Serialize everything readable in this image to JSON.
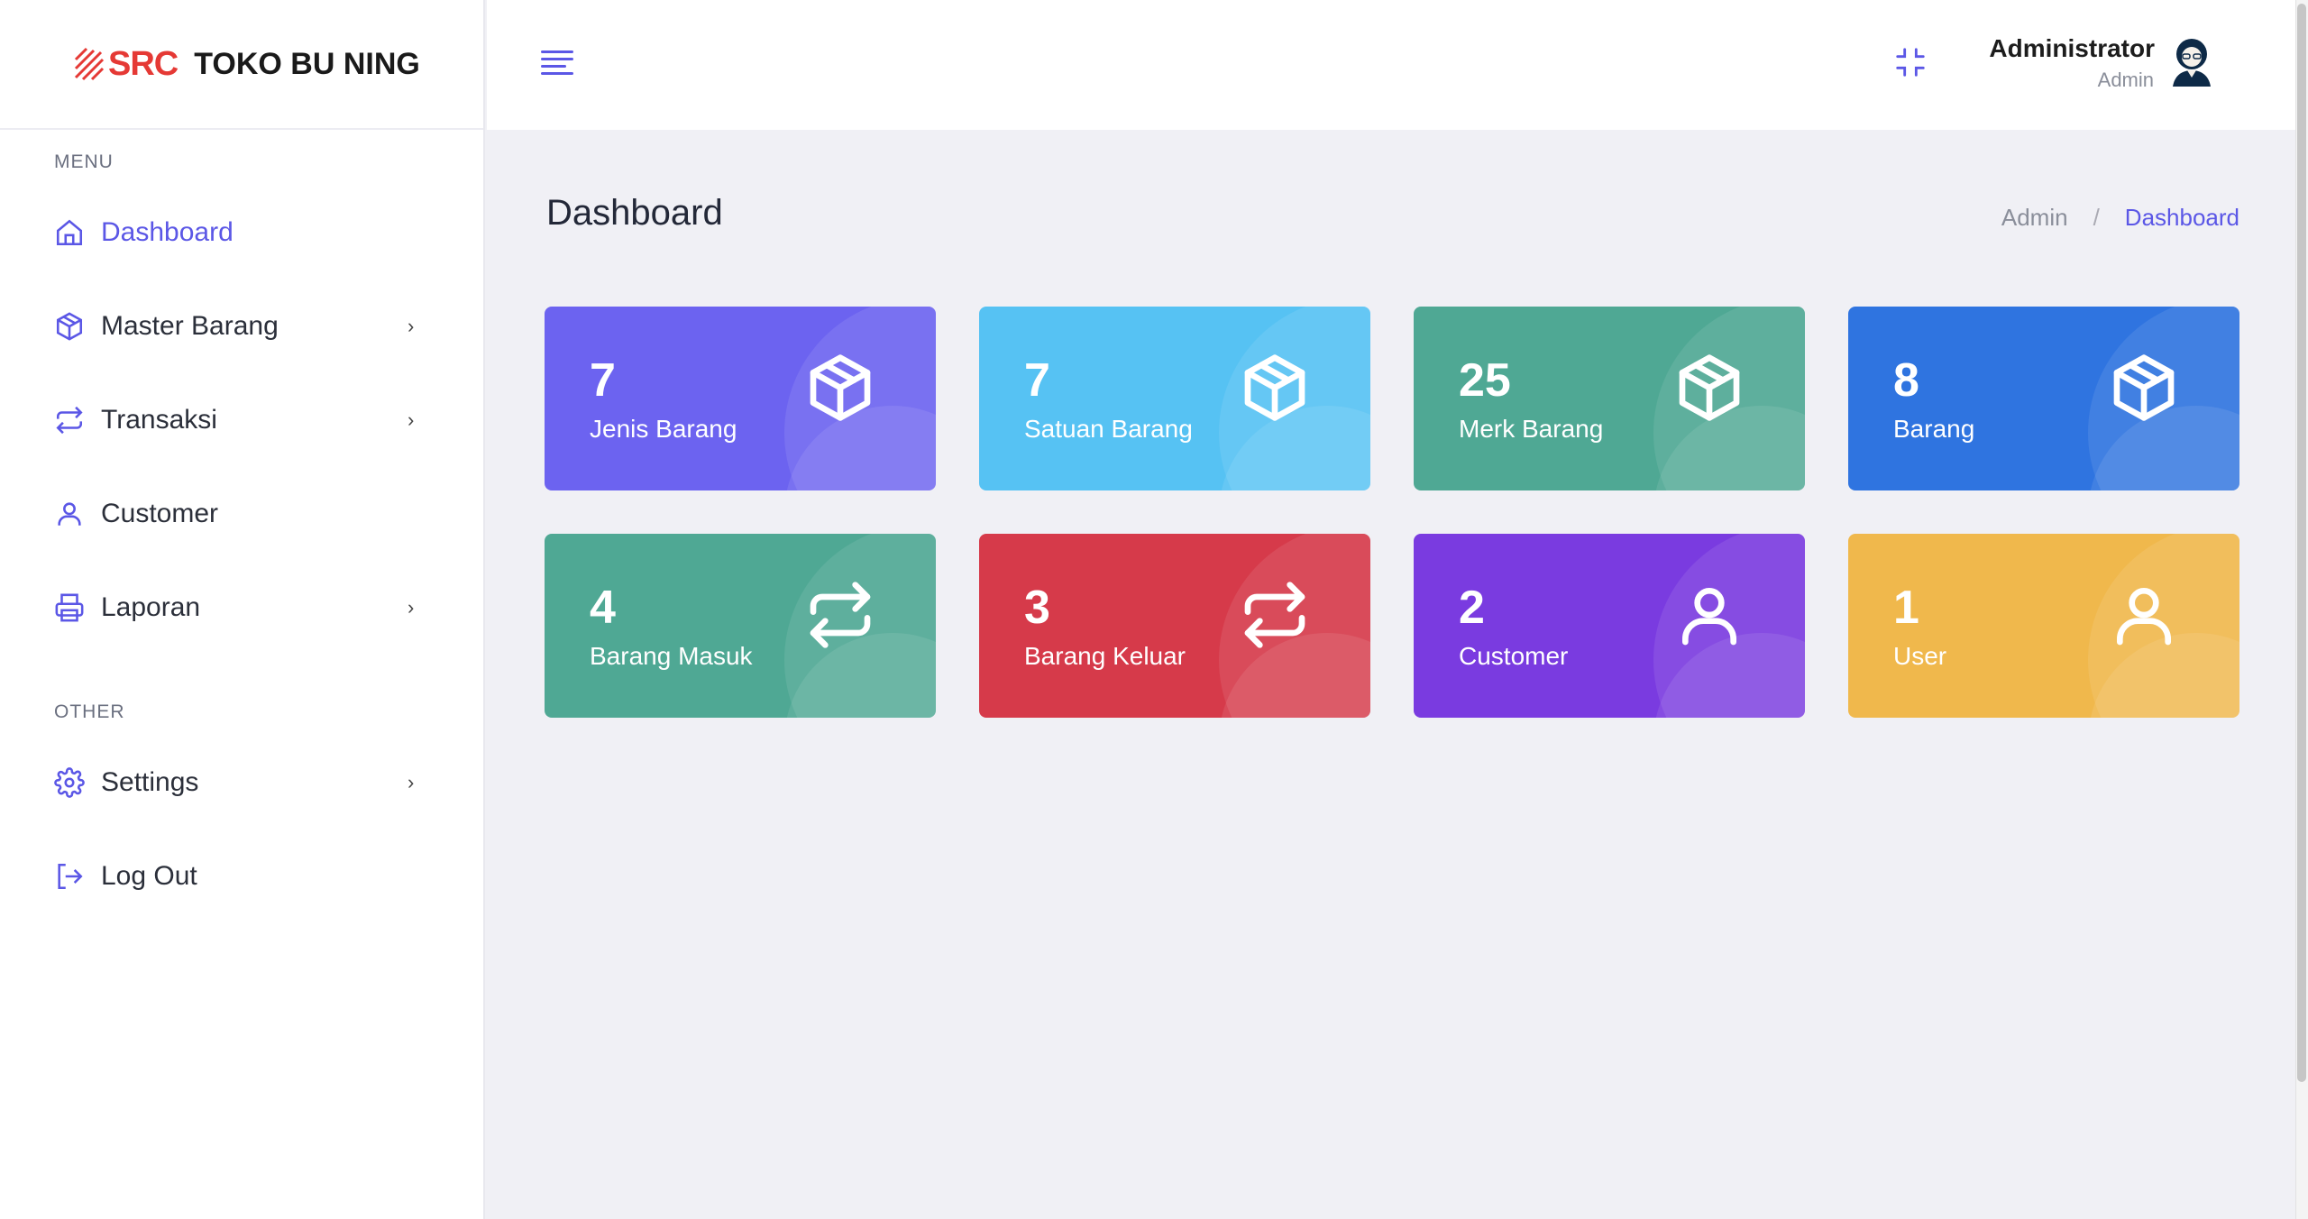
{
  "brand": {
    "logo_text": "SRC",
    "name": "TOKO BU NING"
  },
  "sidebar": {
    "section_menu": "MENU",
    "section_other": "OTHER",
    "items": [
      {
        "label": "Dashboard",
        "icon": "home-icon"
      },
      {
        "label": "Master Barang",
        "icon": "box-icon"
      },
      {
        "label": "Transaksi",
        "icon": "repeat-icon"
      },
      {
        "label": "Customer",
        "icon": "user-icon"
      },
      {
        "label": "Laporan",
        "icon": "printer-icon"
      }
    ],
    "other_items": [
      {
        "label": "Settings",
        "icon": "gear-icon"
      },
      {
        "label": "Log Out",
        "icon": "logout-icon"
      }
    ]
  },
  "header": {
    "user_name": "Administrator",
    "user_role": "Admin"
  },
  "page": {
    "title": "Dashboard",
    "breadcrumb": [
      "Admin",
      "/",
      "Dashboard"
    ]
  },
  "cards": [
    {
      "value": "7",
      "label": "Jenis Barang",
      "icon": "box-icon",
      "color": "#6c63f0"
    },
    {
      "value": "7",
      "label": "Satuan Barang",
      "icon": "box-icon",
      "color": "#56c2f3"
    },
    {
      "value": "25",
      "label": "Merk Barang",
      "icon": "box-icon",
      "color": "#4fa894"
    },
    {
      "value": "8",
      "label": "Barang",
      "icon": "box-icon",
      "color": "#2f74e0"
    },
    {
      "value": "4",
      "label": "Barang Masuk",
      "icon": "repeat-icon",
      "color": "#4fa894"
    },
    {
      "value": "3",
      "label": "Barang Keluar",
      "icon": "repeat-icon",
      "color": "#d63a4a"
    },
    {
      "value": "2",
      "label": "Customer",
      "icon": "user-icon",
      "color": "#7a3be0"
    },
    {
      "value": "1",
      "label": "User",
      "icon": "user-icon",
      "color": "#f0b84c"
    }
  ]
}
